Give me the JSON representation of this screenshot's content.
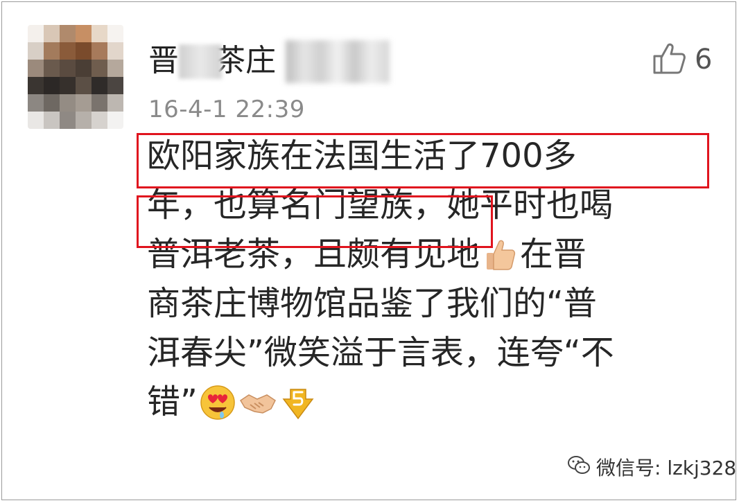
{
  "comment": {
    "username_visible_start": "晋",
    "username_visible_mid": "茶庄",
    "like_count": "6",
    "timestamp": "16-4-1 22:39",
    "lines": [
      "欧阳家族在法国生活了700多",
      "年，也算名门望族，她平时也喝",
      "普洱老茶，且颇有见地",
      "在晋",
      "商茶庄博物馆品鉴了我们的“普",
      "洱春尖”微笑溢于言表，连夸“不",
      "错”"
    ]
  },
  "watermark": {
    "text": "微信号: lzkj328",
    "icon": "wechat-logo-icon"
  },
  "icons": [
    "thumbs-up-outline-icon",
    "thumbs-up-emoji-icon",
    "heart-eyes-emoji-icon",
    "handshake-emoji-icon",
    "number-five-emoji-icon"
  ],
  "colors": {
    "highlight": "#e0141e",
    "text": "#262626",
    "timestamp": "#8a8a8a"
  }
}
